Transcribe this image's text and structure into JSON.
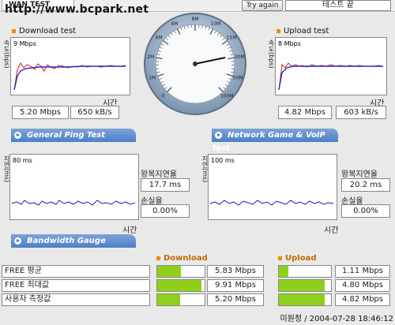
{
  "header": {
    "tab_label": "WAN TEST",
    "watermark": "http://www.bcpark.net",
    "try_again_label": "Try again",
    "test_field_value": "테스트 끝"
  },
  "download": {
    "title": "Download test",
    "y_axis_label": "속도(bps)",
    "scale": "9 Mbps",
    "x_axis_label": "시간",
    "mbps": "5.20 Mbps",
    "kbs": "650 kB/s"
  },
  "upload": {
    "title": "Upload test",
    "y_axis_label": "속도(bps)",
    "scale": "8 Mbps",
    "x_axis_label": "시간",
    "mbps": "4.82 Mbps",
    "kbs": "603 kB/s"
  },
  "gauge": {
    "tick_labels": [
      "0",
      "1M",
      "2M",
      "4M",
      "6M",
      "8M",
      "10M",
      "15M",
      "20M",
      "50M",
      "100M"
    ]
  },
  "ping": {
    "banner": "General Ping Test",
    "y_axis_label": "지연(ms)",
    "scale": "80 ms",
    "x_axis_label": "시간",
    "latency_label": "왕복지연율",
    "latency_value": "17.7 ms",
    "loss_label": "손실율",
    "loss_value": "0.00%"
  },
  "game": {
    "banner": "Network Game & VoIP Test",
    "y_axis_label": "지연(ms)",
    "scale": "100 ms",
    "x_axis_label": "시간",
    "latency_label": "왕복지연율",
    "latency_value": "20.2 ms",
    "loss_label": "손실율",
    "loss_value": "0.00%"
  },
  "bandwidth": {
    "banner": "Bandwidth Gauge",
    "download_header": "Download",
    "upload_header": "Upload",
    "rows": [
      {
        "label": "FREE 평균",
        "download": "5.83 Mbps",
        "download_level": 0.5,
        "upload": "1.11 Mbps",
        "upload_level": 0.18
      },
      {
        "label": "FREE 최대값",
        "download": "9.91 Mbps",
        "download_level": 0.93,
        "upload": "4.80 Mbps",
        "upload_level": 0.88
      },
      {
        "label": "사용자 측정값",
        "download": "5.20 Mbps",
        "download_level": 0.48,
        "upload": "4.82 Mbps",
        "upload_level": 0.88
      }
    ]
  },
  "footer": {
    "signature": "미원정 / 2004-07-28 18:46:12"
  },
  "colors": {
    "download_series": "#d42020",
    "avg_series": "#2030c8",
    "ping_series": "#1a1aa8",
    "bar_fill": "#8fd11a",
    "accent_dot": "#f08a00",
    "banner_blue": "#4e7fc6"
  }
}
